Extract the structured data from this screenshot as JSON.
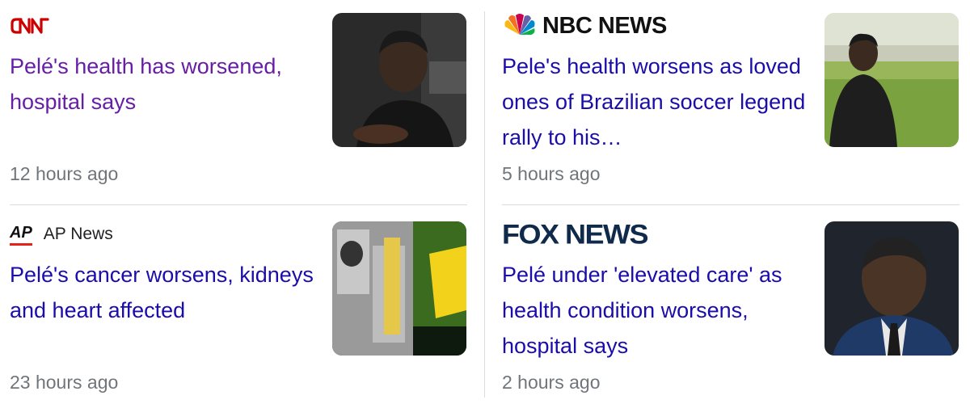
{
  "articles": [
    {
      "source": "CNN",
      "headline": "Pelé's health has worsened, hospital says",
      "time": "12 hours ago",
      "visited": true
    },
    {
      "source": "NBC NEWS",
      "headline": "Pele's health worsens as loved ones of Brazilian soccer legend rally to his…",
      "time": "5 hours ago",
      "visited": false
    },
    {
      "source": "AP News",
      "source_mark": "AP",
      "headline": "Pelé's cancer worsens, kidneys and heart affected",
      "time": "23 hours ago",
      "visited": false
    },
    {
      "source": "FOX NEWS",
      "headline": "Pelé under 'elevated care' as health condition worsens, hospital says",
      "time": "2 hours ago",
      "visited": false
    }
  ],
  "colors": {
    "link": "#1a0dab",
    "visited": "#681da8",
    "meta": "#70757a",
    "divider": "#dadce0",
    "cnn_red": "#cc0000",
    "ap_red": "#e2231a",
    "fox_navy": "#0f2a4a"
  },
  "icons": {
    "cnn": "cnn-logo",
    "nbc": "nbc-peacock-logo",
    "ap": "ap-logo",
    "fox": "fox-news-logo"
  }
}
